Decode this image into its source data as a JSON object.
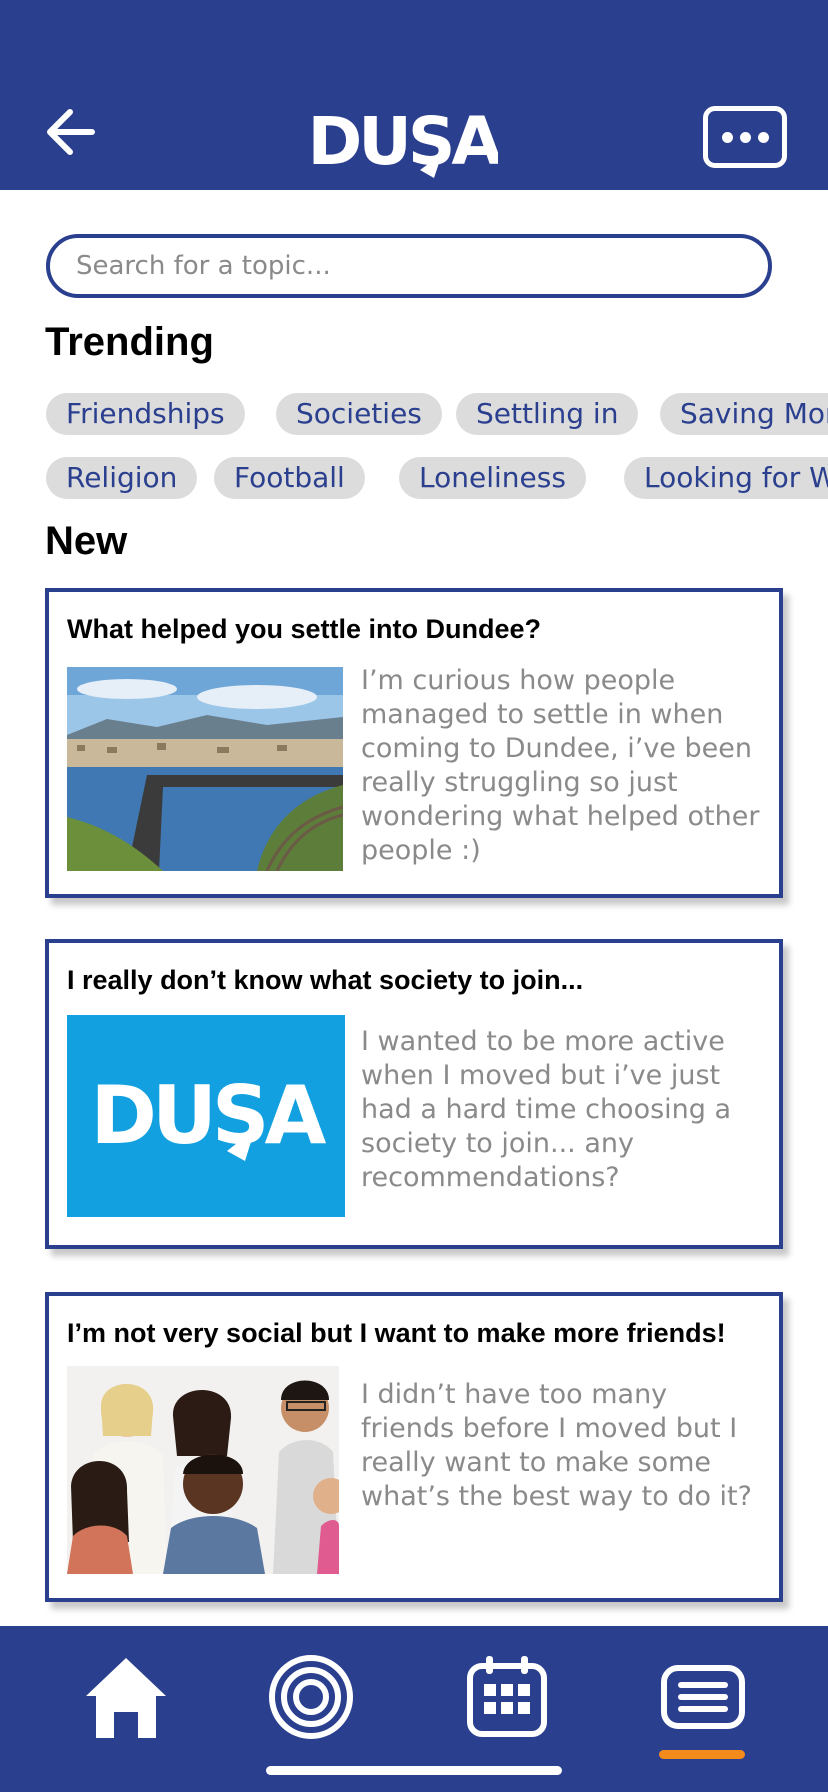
{
  "header": {
    "logo_text": "DUSA",
    "back_icon": "back-arrow-icon",
    "more_icon": "more-dots-icon"
  },
  "search": {
    "placeholder": "Search for a topic..."
  },
  "trending": {
    "title": "Trending",
    "row1": [
      "Friendships",
      "Societies",
      "Settling in",
      "Saving Mor"
    ],
    "row2": [
      "Religion",
      "Football",
      "Loneliness",
      "Looking for W"
    ]
  },
  "new_section": {
    "title": "New"
  },
  "posts": [
    {
      "title": "What helped you settle into Dundee?",
      "body": "I’m curious how people managed to settle in when coming to Dundee, i’ve been really struggling so just wondering what helped other people :)",
      "image": "dundee-bridge-photo"
    },
    {
      "title": "I really don’t know what society to join...",
      "body": "I wanted to be more active when I moved but i’ve just had a hard time choosing a society to join... any recommendations?",
      "image": "dusa-logo-image",
      "image_text": "DUSA"
    },
    {
      "title": "I’m not very social but I want to make more friends!",
      "body": "I didn’t have too many friends before I moved but I really want to make some what’s the best way to do it?",
      "image": "group-of-friends-photo"
    }
  ],
  "nav": {
    "items": [
      "home-icon",
      "target-icon",
      "calendar-icon",
      "forum-icon"
    ],
    "active": "forum-icon"
  },
  "colors": {
    "brand": "#2b3f8f",
    "accent": "#f28a1c",
    "chip_bg": "#dcdcdc",
    "dusa_blue": "#12a0e0"
  }
}
